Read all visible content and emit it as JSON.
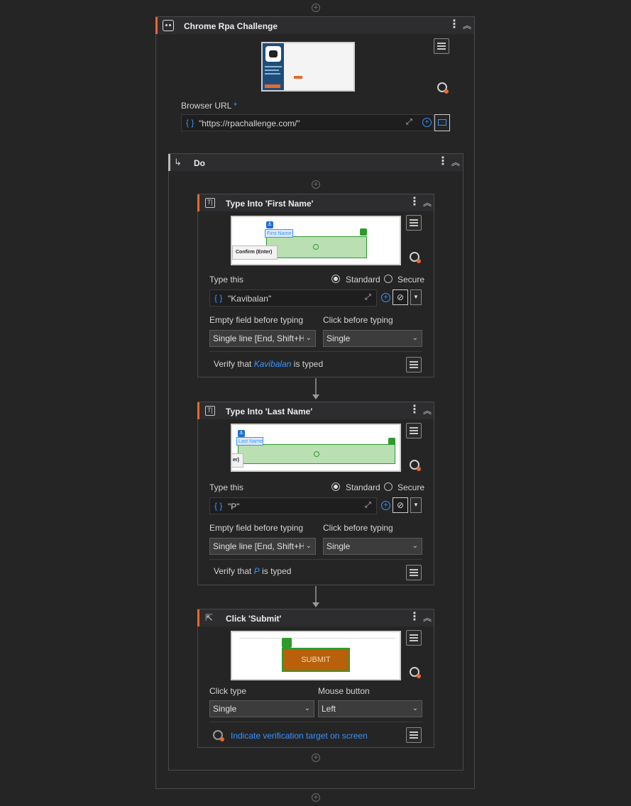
{
  "outer": {
    "title": "Chrome Rpa Challenge",
    "browser_url_label": "Browser URL",
    "required_mark": "*",
    "url_value": "\"https://rpachallenge.com/\""
  },
  "do": {
    "title": "Do"
  },
  "type_first": {
    "title": "Type Into 'First Name'",
    "shot_tag": "First Name",
    "shot_tooltip": "Confirm (Enter)",
    "type_this_label": "Type this",
    "standard_label": "Standard",
    "secure_label": "Secure",
    "value": "\"Kavibalan\"",
    "empty_field_label": "Empty field before typing",
    "empty_field_value": "Single line [End, Shift+Home, Del]",
    "click_before_label": "Click before typing",
    "click_before_value": "Single",
    "verify_prefix": "Verify that",
    "verify_value": "Kavibalan",
    "verify_suffix": "is typed"
  },
  "type_last": {
    "title": "Type Into 'Last Name'",
    "shot_tag": "Last Name",
    "shot_tooltip": "er)",
    "type_this_label": "Type this",
    "standard_label": "Standard",
    "secure_label": "Secure",
    "value": "\"P\"",
    "empty_field_label": "Empty field before typing",
    "empty_field_value": "Single line [End, Shift+Home, Del]",
    "click_before_label": "Click before typing",
    "click_before_value": "Single",
    "verify_prefix": "Verify that",
    "verify_value": "P",
    "verify_suffix": "is typed"
  },
  "click_submit": {
    "title": "Click 'Submit'",
    "shot_button": "SUBMIT",
    "click_type_label": "Click type",
    "click_type_value": "Single",
    "mouse_button_label": "Mouse button",
    "mouse_button_value": "Left",
    "indicate_label": "Indicate verification target on screen"
  },
  "colors": {
    "accent": "#e8692c",
    "link": "#3794ff",
    "target_green": "#2e9a2e",
    "submit_orange": "#b8600a"
  },
  "icons": [
    "add-activity-icon",
    "robot-icon",
    "kebab-menu-icon",
    "collapse-icon",
    "properties-menu-icon",
    "indicate-target-icon",
    "expand-icon",
    "add-icon",
    "browser-icon",
    "type-into-icon",
    "hide-icon",
    "dropdown-icon",
    "click-icon",
    "flow-arrow-icon"
  ]
}
